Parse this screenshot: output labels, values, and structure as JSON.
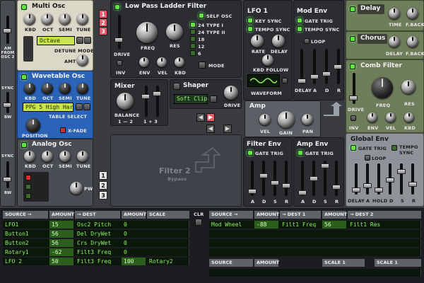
{
  "multi_osc": {
    "title": "Multi Osc",
    "labels": [
      "KBD",
      "OCT",
      "SEMI",
      "TUNE"
    ],
    "mode_value": "Octave",
    "mode_label": "DETUNE MODE",
    "amt_label": "AMT"
  },
  "wavetable_osc": {
    "title": "Wavetable Osc",
    "labels": [
      "KBD",
      "OCT",
      "SEMI",
      "TUNE"
    ],
    "table_value": "PPG 5 High Harm",
    "table_label": "TABLE SELECT",
    "position_label": "POSITION",
    "xfade_label": "X-FADE"
  },
  "analog_osc": {
    "title": "Analog Osc",
    "labels": [
      "KBD",
      "OCT",
      "SEMI",
      "TUNE"
    ],
    "pw_label": "PW"
  },
  "left_strip": {
    "am_label": "AM FROM OSC 2",
    "sync1": "SYNC",
    "bw1": "BW",
    "sync2": "SYNC",
    "bw2": "BW"
  },
  "route_badges": [
    "1",
    "2",
    "3"
  ],
  "lpf": {
    "title": "Low Pass Ladder Filter",
    "self_osc": "SELF OSC",
    "types": [
      "24 TYPE I",
      "24 TYPE II",
      "18",
      "12",
      "6"
    ],
    "freq": "FREQ",
    "res": "RES",
    "drive": "DRIVE",
    "mode": "MODE",
    "row": [
      "INV",
      "ENV",
      "VEL",
      "KBD"
    ]
  },
  "lfo1": {
    "title": "LFO 1",
    "key_sync": "KEY SYNC",
    "tempo_sync": "TEMPO SYNC",
    "rate": "RATE",
    "delay": "DELAY",
    "kbd_follow": "KBD FOLLOW",
    "waveform": "WAVEFORM"
  },
  "mod_env": {
    "title": "Mod Env",
    "gate_trig": "GATE TRIG",
    "tempo_sync": "TEMPO SYNC",
    "loop": "LOOP",
    "sliders": [
      "DELAY",
      "A",
      "D",
      "R"
    ]
  },
  "mixer": {
    "title": "Mixer",
    "balance": "BALANCE",
    "b1": "1 — 2",
    "b2": "1 + 3"
  },
  "shaper": {
    "title": "Shaper",
    "value": "Soft Clip",
    "drive": "DRIVE"
  },
  "amp": {
    "title": "Amp",
    "vel": "VEL",
    "gain": "GAIN",
    "pan": "PAN"
  },
  "filter2": {
    "title": "Filter 2",
    "sub": "Bypass"
  },
  "filter_env": {
    "title": "Filter Env",
    "gate_trig": "GATE TRIG",
    "sliders": [
      "A",
      "D",
      "S",
      "R"
    ]
  },
  "amp_env": {
    "title": "Amp Env",
    "gate_trig": "GATE TRIG",
    "sliders": [
      "A",
      "D",
      "S",
      "R"
    ]
  },
  "delay": {
    "title": "Delay",
    "time": "TIME",
    "fback": "F.BACK"
  },
  "chorus": {
    "title": "Chorus",
    "delay": "DELAY",
    "fback": "F.BACK"
  },
  "comb": {
    "title": "Comb Filter",
    "freq": "FREQ",
    "res": "RES",
    "drive": "DRIVE",
    "row": [
      "INV",
      "ENV",
      "VEL",
      "KBD"
    ]
  },
  "global_env": {
    "title": "Global Env",
    "gate_trig": "GATE TRIG",
    "tempo_sync": "TEMPO SYNC",
    "loop": "LOOP",
    "sliders": [
      "DELAY",
      "A",
      "HOLD",
      "D",
      "S",
      "R"
    ]
  },
  "matrix_left": {
    "headers": [
      "SOURCE →",
      "AMOUNT",
      "→ DEST",
      "AMOUNT",
      "SCALE"
    ],
    "rows": [
      [
        "LFO1",
        "15",
        "Osc2 Pitch",
        "0",
        ""
      ],
      [
        "Button1",
        "56",
        "Del DryWet",
        "0",
        ""
      ],
      [
        "Button2",
        "56",
        "Crs DryWet",
        "0",
        ""
      ],
      [
        "Rotary1",
        "-62",
        "Filt3 Freq",
        "0",
        ""
      ],
      [
        "LFO 2",
        "50",
        "Filt3 Freq",
        "100",
        "Rotary2"
      ]
    ]
  },
  "clr": "CLR",
  "matrix_right": {
    "headers": [
      "SOURCE →",
      "AMOUNT",
      "→ DEST 1",
      "AMOUNT",
      "→ DEST 2"
    ],
    "row": [
      "Mod Wheel",
      "-88",
      "Filt1 Freq",
      "56",
      "Filt1 Res"
    ],
    "headers2": [
      "SOURCE",
      "AMOUNT",
      "SCALE 1",
      "SCALE 1"
    ]
  }
}
